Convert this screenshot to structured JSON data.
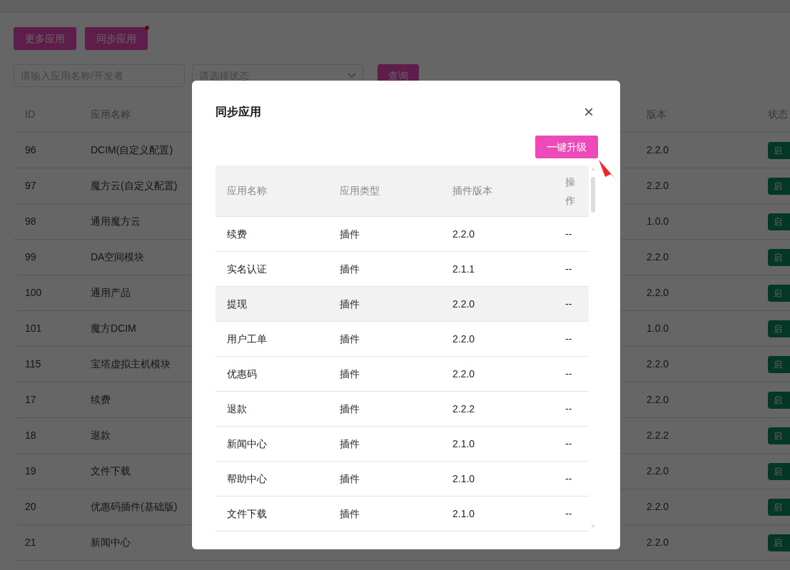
{
  "toolbar": {
    "buttons": [
      {
        "label": "更多应用",
        "badge": false
      },
      {
        "label": "同步应用",
        "badge": true
      }
    ]
  },
  "filters": {
    "search": {
      "placeholder": "请输入应用名称/开发者"
    },
    "status_select": {
      "placeholder": "请选择状态"
    },
    "query_button": "查询"
  },
  "table": {
    "columns": [
      "ID",
      "应用名称",
      "版本",
      "状态"
    ],
    "rows": [
      {
        "id": "96",
        "name": "DCIM(自定义配置)",
        "version": "2.2.0",
        "status": "启"
      },
      {
        "id": "97",
        "name": "魔方云(自定义配置)",
        "version": "2.2.0",
        "status": "启"
      },
      {
        "id": "98",
        "name": "通用魔方云",
        "version": "1.0.0",
        "status": "启"
      },
      {
        "id": "99",
        "name": "DA空间模块",
        "version": "2.2.0",
        "status": "启"
      },
      {
        "id": "100",
        "name": "通用产品",
        "version": "2.2.0",
        "status": "启"
      },
      {
        "id": "101",
        "name": "魔方DCIM",
        "version": "1.0.0",
        "status": "启"
      },
      {
        "id": "115",
        "name": "宝塔虚拟主机模块",
        "version": "2.2.0",
        "status": "启"
      },
      {
        "id": "17",
        "name": "续费",
        "version": "2.2.0",
        "status": "启"
      },
      {
        "id": "18",
        "name": "退款",
        "version": "2.2.2",
        "status": "启"
      },
      {
        "id": "19",
        "name": "文件下载",
        "version": "2.2.0",
        "status": "启"
      },
      {
        "id": "20",
        "name": "优惠码插件(基础版)",
        "version": "2.2.0",
        "status": "启"
      },
      {
        "id": "21",
        "name": "新闻中心",
        "version": "2.2.0",
        "status": "启"
      }
    ]
  },
  "dialog": {
    "title": "同步应用",
    "close": "×",
    "upgrade_button": "一键升级",
    "columns": [
      "应用名称",
      "应用类型",
      "插件版本",
      "操作"
    ],
    "rows": [
      {
        "name": "续费",
        "type": "插件",
        "version": "2.2.0",
        "action": "--",
        "selected": false
      },
      {
        "name": "实名认证",
        "type": "插件",
        "version": "2.1.1",
        "action": "--",
        "selected": false
      },
      {
        "name": "提现",
        "type": "插件",
        "version": "2.2.0",
        "action": "--",
        "selected": true
      },
      {
        "name": "用户工单",
        "type": "插件",
        "version": "2.2.0",
        "action": "--",
        "selected": false
      },
      {
        "name": "优惠码",
        "type": "插件",
        "version": "2.2.0",
        "action": "--",
        "selected": false
      },
      {
        "name": "退款",
        "type": "插件",
        "version": "2.2.2",
        "action": "--",
        "selected": false
      },
      {
        "name": "新闻中心",
        "type": "插件",
        "version": "2.1.0",
        "action": "--",
        "selected": false
      },
      {
        "name": "帮助中心",
        "type": "插件",
        "version": "2.1.0",
        "action": "--",
        "selected": false
      },
      {
        "name": "文件下载",
        "type": "插件",
        "version": "2.1.0",
        "action": "--",
        "selected": false
      }
    ]
  }
}
